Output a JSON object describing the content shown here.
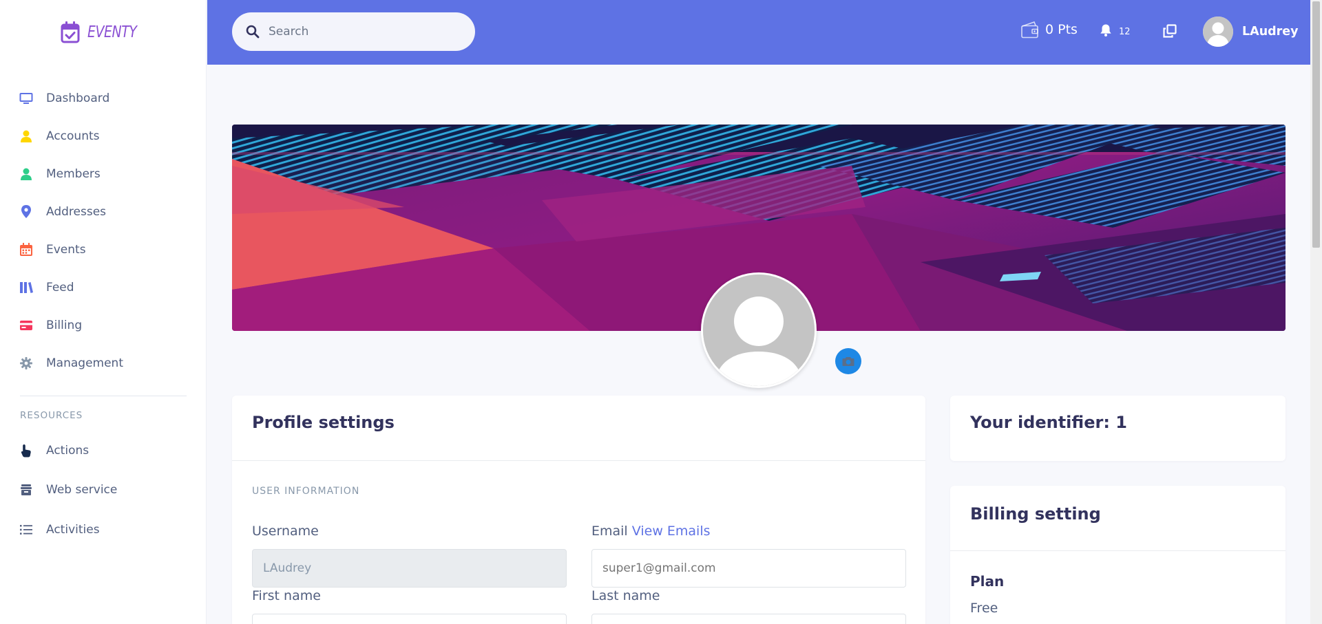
{
  "brand": {
    "name": "EVENTY",
    "color": "#8a4fd3"
  },
  "sidebar": {
    "items": [
      {
        "label": "Dashboard",
        "icon": "monitor-icon",
        "color": "#5e72e4"
      },
      {
        "label": "Accounts",
        "icon": "user-icon",
        "color": "#ffd600"
      },
      {
        "label": "Members",
        "icon": "user-icon",
        "color": "#2dce89"
      },
      {
        "label": "Addresses",
        "icon": "map-pin-icon",
        "color": "#5e72e4"
      },
      {
        "label": "Events",
        "icon": "calendar-icon",
        "color": "#fb6340"
      },
      {
        "label": "Feed",
        "icon": "books-icon",
        "color": "#5e72e4"
      },
      {
        "label": "Billing",
        "icon": "credit-card-icon",
        "color": "#f5365c"
      },
      {
        "label": "Management",
        "icon": "gear-icon",
        "color": "#8898aa"
      }
    ],
    "resources_heading": "RESOURCES",
    "resources": [
      {
        "label": "Actions",
        "icon": "pointer-hand-icon",
        "color": "#172b4d"
      },
      {
        "label": "Web service",
        "icon": "archive-icon",
        "color": "#525f7f"
      },
      {
        "label": "Activities",
        "icon": "list-icon",
        "color": "#525f7f"
      }
    ]
  },
  "topbar": {
    "background": "#5e72e4",
    "search_placeholder": "Search",
    "points": "0 Pts",
    "notifications_count": "12",
    "user_name": "LAudrey"
  },
  "profile": {
    "title": "Profile settings",
    "section": "USER INFORMATION",
    "username_label": "Username",
    "username_value": "LAudrey",
    "email_label": "Email",
    "email_link": "View Emails",
    "email_placeholder": "super1@gmail.com",
    "first_name_label": "First name",
    "last_name_label": "Last name"
  },
  "identifier": {
    "title": "Your identifier: 1"
  },
  "billing": {
    "title": "Billing setting",
    "plan_label": "Plan",
    "plan_value": "Free"
  }
}
